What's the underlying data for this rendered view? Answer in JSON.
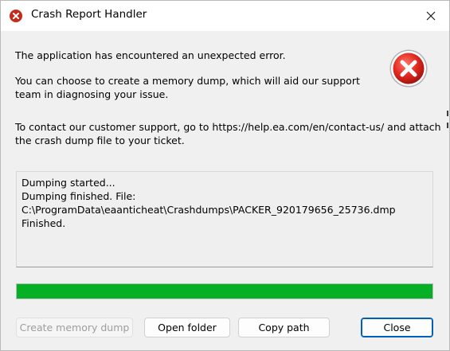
{
  "window": {
    "title": "Crash Report Handler"
  },
  "icons": {
    "title_icon": "error-icon",
    "dialog_icon": "error-icon",
    "close_icon": "close-icon",
    "error_color": "#d32f2f"
  },
  "message": {
    "line1": "The application has encountered an unexpected error.",
    "line2a": "You can choose to create a memory dump, which will aid our support",
    "line2b": "team in diagnosing your issue.",
    "line3a": "To contact our customer support, go to https://help.ea.com/en/contact-us/ and attach",
    "line3b": "the crash dump file to your ticket."
  },
  "log": {
    "lines": [
      "Dumping started...",
      "Dumping finished. File:",
      "C:\\ProgramData\\eaanticheat\\Crashdumps\\PACKER_920179656_25736.dmp",
      "Finished."
    ]
  },
  "progress": {
    "percent": 100,
    "color": "#06b025"
  },
  "buttons": {
    "create_dump": "Create memory dump",
    "open_folder": "Open folder",
    "copy_path": "Copy path",
    "close": "Close"
  }
}
